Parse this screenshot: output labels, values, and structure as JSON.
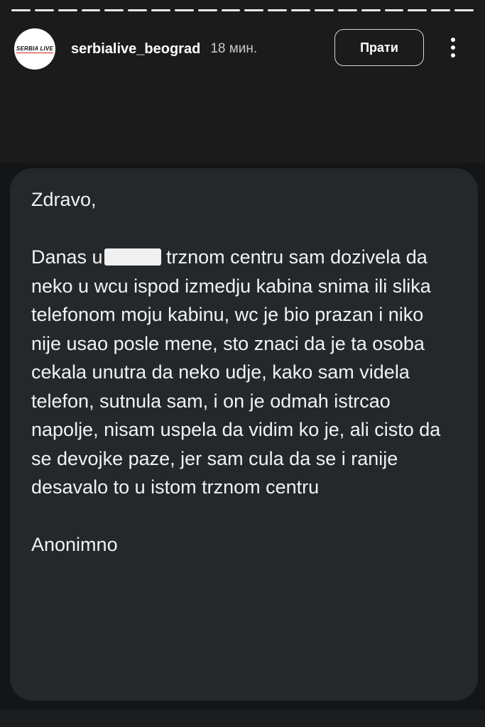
{
  "story": {
    "progress_segments": 20,
    "account": {
      "avatar_logo_text": "SERBIA LIVE",
      "username": "serbialive_beograd",
      "time_ago": "18 мин."
    },
    "follow_label": "Прати",
    "more_icon": "more-vertical-icon"
  },
  "message": {
    "greeting": "Zdravo,",
    "body_before_redaction": "Danas u",
    "body_after_redaction": "trznom centru sam dozivela da neko u wcu ispod izmedju kabina snima ili slika telefonom moju kabinu, wc je bio prazan i niko nije usao posle mene, sto znaci da je ta osoba cekala unutra da neko udje, kako sam videla telefon, sutnula sam, i on je odmah istrcao napolje, nisam uspela da vidim ko je, ali cisto da se devojke paze, jer sam cula da se i ranije desavalo to u istom trznom centru",
    "signature": "Anonimno"
  },
  "colors": {
    "background": "#131516",
    "top_area": "#1b1b1b",
    "card": "#25282b",
    "text": "#f2f2f2",
    "redaction": "#f0f0f0"
  }
}
